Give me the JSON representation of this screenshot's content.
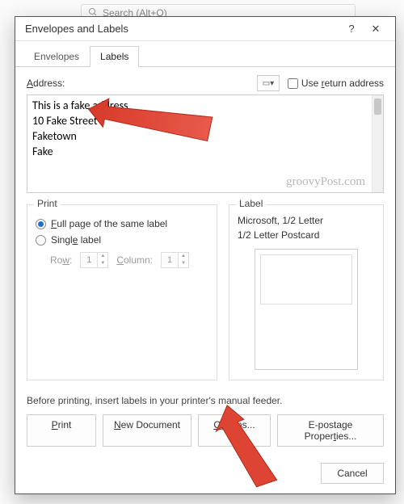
{
  "backdrop": {
    "search_placeholder": "Search (Alt+Q)"
  },
  "dialog": {
    "title": "Envelopes and Labels",
    "help": "?",
    "close": "✕"
  },
  "tabs": {
    "envelopes": "Envelopes",
    "labels": "Labels"
  },
  "address": {
    "label": "Address:",
    "use_return_label": "Use return address",
    "text": "This is a fake address\n10 Fake Street\nFaketown\nFake"
  },
  "watermark": "groovyPost.com",
  "print": {
    "title": "Print",
    "full_page": "Full page of the same label",
    "single": "Single label",
    "row_label": "Row:",
    "row_value": "1",
    "col_label": "Column:",
    "col_value": "1"
  },
  "label": {
    "title": "Label",
    "line1": "Microsoft, 1/2 Letter",
    "line2": "1/2 Letter Postcard"
  },
  "hint": "Before printing, insert labels in your printer's manual feeder.",
  "buttons": {
    "print": "Print",
    "new_doc": "New Document",
    "options": "Options...",
    "epostage": "E-postage Properties...",
    "cancel": "Cancel"
  }
}
